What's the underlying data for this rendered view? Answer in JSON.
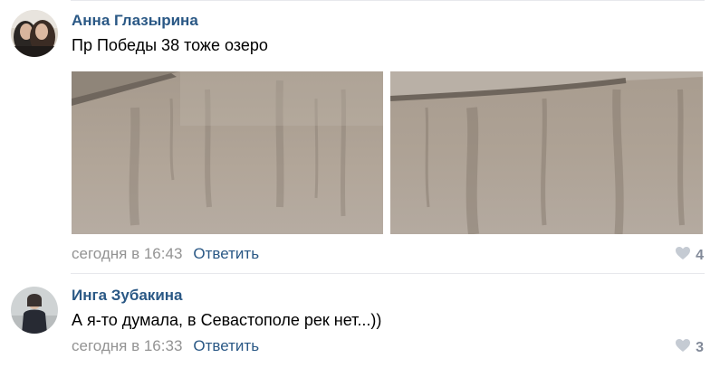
{
  "comments": [
    {
      "author": "Анна Глазырина",
      "text": "Пр Победы 38 тоже озеро",
      "date": "сегодня в 16:43",
      "reply_label": "Ответить",
      "likes": "4",
      "avatar_icon": "user-photo-two-women",
      "photos": [
        {
          "icon": "photo-flooded-street-1"
        },
        {
          "icon": "photo-flooded-street-2"
        }
      ]
    },
    {
      "author": "Инга Зубакина",
      "text": "А я-то думала, в Севастополе рек нет...))",
      "date": "сегодня в 16:33",
      "reply_label": "Ответить",
      "likes": "3",
      "avatar_icon": "user-photo-woman-dark-coat"
    }
  ],
  "colors": {
    "link": "#2a5885",
    "meta": "#939393",
    "like_icon": "#c5cbd3",
    "divider": "#e7e8ec"
  }
}
